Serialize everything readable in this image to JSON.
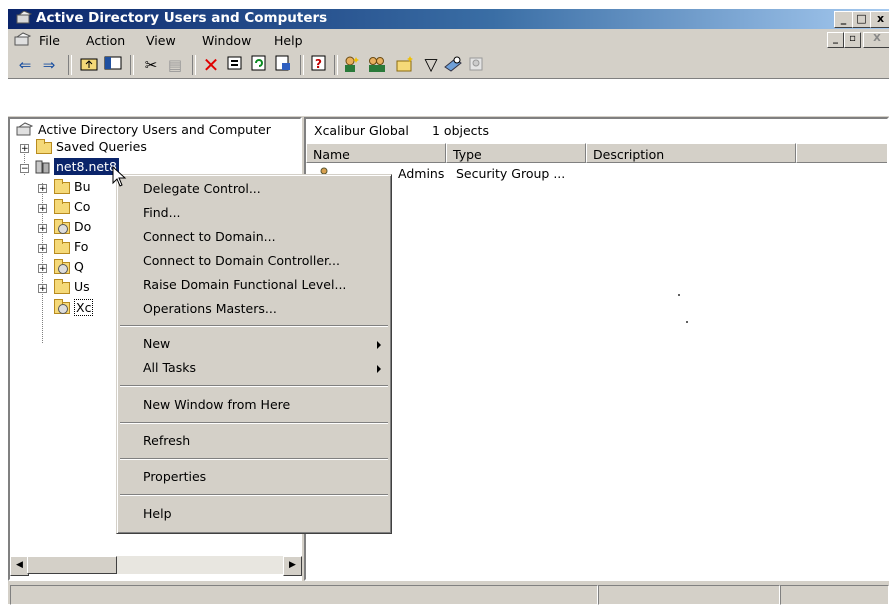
{
  "window": {
    "title": "Active Directory Users and Computers"
  },
  "menubar": {
    "items": [
      {
        "label": "File"
      },
      {
        "label": "Action"
      },
      {
        "label": "View"
      },
      {
        "label": "Window"
      },
      {
        "label": "Help"
      }
    ]
  },
  "toolbar": {
    "icons": [
      "back-icon",
      "forward-icon",
      "up-folder-icon",
      "show-tree-icon",
      "cut-icon",
      "paste-icon",
      "delete-icon",
      "properties-icon",
      "refresh-icon",
      "export-list-icon",
      "help-icon",
      "new-user-icon",
      "new-group-icon",
      "new-ou-icon",
      "filter-icon",
      "find-icon",
      "add-to-group-icon"
    ]
  },
  "tree": {
    "root": "Active Directory Users and Computer",
    "saved_queries": "Saved Queries",
    "domain": "net8.net8",
    "children": [
      {
        "label": "Bu",
        "icon": "folder"
      },
      {
        "label": "Co",
        "icon": "folder"
      },
      {
        "label": "Do",
        "icon": "ou"
      },
      {
        "label": "Fo",
        "icon": "folder"
      },
      {
        "label": "Q",
        "icon": "ou"
      },
      {
        "label": "Us",
        "icon": "folder"
      },
      {
        "label": "Xc",
        "icon": "ou"
      }
    ]
  },
  "details": {
    "location": "Xcalibur Global",
    "count": "1 objects",
    "columns": [
      "Name",
      "Type",
      "Description"
    ],
    "rows": [
      {
        "name": "Admins",
        "type": "Security Group ...",
        "description": ""
      }
    ]
  },
  "context_menu": {
    "items": [
      {
        "label": "Delegate Control...",
        "submenu": false
      },
      {
        "label": "Find...",
        "submenu": false
      },
      {
        "label": "Connect to Domain...",
        "submenu": false
      },
      {
        "label": "Connect to Domain Controller...",
        "submenu": false
      },
      {
        "label": "Raise Domain Functional Level...",
        "submenu": false
      },
      {
        "label": "Operations Masters...",
        "submenu": false
      },
      {
        "label": "New",
        "submenu": true
      },
      {
        "label": "All Tasks",
        "submenu": true
      },
      {
        "label": "New Window from Here",
        "submenu": false
      },
      {
        "label": "Refresh",
        "submenu": false
      },
      {
        "label": "Properties",
        "submenu": false
      },
      {
        "label": "Help",
        "submenu": false
      }
    ]
  },
  "colors": {
    "titlebar_start": "#0a246a",
    "titlebar_end": "#a6caf0",
    "selection": "#0a246a",
    "face": "#d4d0c8"
  }
}
